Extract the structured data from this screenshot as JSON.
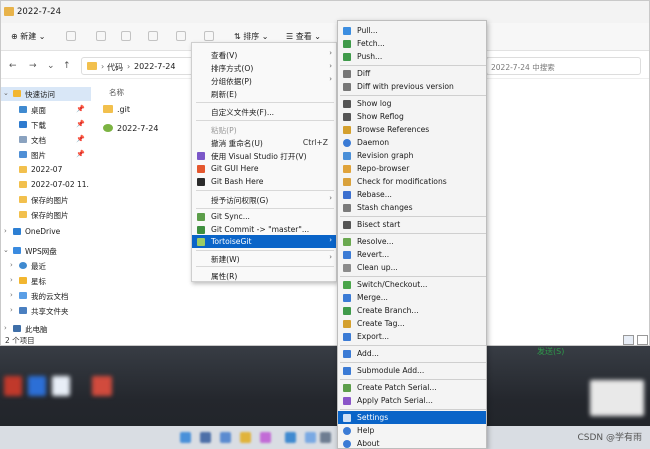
{
  "window": {
    "title": "2022-7-24"
  },
  "toolbar": {
    "new_label": "新建",
    "sort_label": "排序",
    "view_label": "查看"
  },
  "address": {
    "crumbs": [
      "代码",
      "2022-7-24"
    ],
    "search_placeholder": "2022-7-24 中搜索"
  },
  "sidebar": {
    "items": [
      {
        "label": "快速访问",
        "icon": "star-icon"
      },
      {
        "label": "桌面",
        "icon": "desktop-icon"
      },
      {
        "label": "下载",
        "icon": "download-icon"
      },
      {
        "label": "文档",
        "icon": "document-icon"
      },
      {
        "label": "图片",
        "icon": "picture-icon"
      },
      {
        "label": "2022-07",
        "icon": "folder-icon"
      },
      {
        "label": "2022-07-02 11.",
        "icon": "folder-icon"
      },
      {
        "label": "保存的图片",
        "icon": "folder-icon"
      },
      {
        "label": "保存的图片",
        "icon": "folder-icon"
      },
      {
        "label": "OneDrive",
        "icon": "cloud-icon"
      },
      {
        "label": "WPS网盘",
        "icon": "cloud-icon"
      },
      {
        "label": "最近",
        "icon": "clock-icon"
      },
      {
        "label": "星标",
        "icon": "star-icon"
      },
      {
        "label": "我的云文档",
        "icon": "cloud-icon"
      },
      {
        "label": "共享文件夹",
        "icon": "share-icon"
      },
      {
        "label": "此电脑",
        "icon": "computer-icon"
      }
    ]
  },
  "status": {
    "count": "2 个项目"
  },
  "content": {
    "column_name": "名称",
    "files": [
      {
        "name": ".git"
      },
      {
        "name": "2022-7-24"
      }
    ],
    "green_text": "发送(S)"
  },
  "menu1": {
    "items": [
      {
        "label": "查看(V)"
      },
      {
        "label": "排序方式(O)"
      },
      {
        "label": "分组依据(P)"
      },
      {
        "label": "刷新(E)"
      },
      {
        "label": "自定义文件夹(F)..."
      },
      {
        "label": "粘贴(P)"
      },
      {
        "label": "撤消 重命名(U)",
        "shortcut": "Ctrl+Z"
      },
      {
        "label": "使用 Visual Studio 打开(V)"
      },
      {
        "label": "Git GUI Here"
      },
      {
        "label": "Git Bash Here"
      },
      {
        "label": "授予访问权限(G)"
      },
      {
        "label": "Git Sync..."
      },
      {
        "label": "Git Commit -> \"master\"..."
      },
      {
        "label": "TortoiseGit"
      },
      {
        "label": "新建(W)"
      },
      {
        "label": "属性(R)"
      }
    ]
  },
  "menu2": {
    "items": [
      {
        "label": "Pull..."
      },
      {
        "label": "Fetch..."
      },
      {
        "label": "Push..."
      },
      {
        "label": "Diff"
      },
      {
        "label": "Diff with previous version"
      },
      {
        "label": "Show log"
      },
      {
        "label": "Show Reflog"
      },
      {
        "label": "Browse References"
      },
      {
        "label": "Daemon"
      },
      {
        "label": "Revision graph"
      },
      {
        "label": "Repo-browser"
      },
      {
        "label": "Check for modifications"
      },
      {
        "label": "Rebase..."
      },
      {
        "label": "Stash changes"
      },
      {
        "label": "Bisect start"
      },
      {
        "label": "Resolve..."
      },
      {
        "label": "Revert..."
      },
      {
        "label": "Clean up..."
      },
      {
        "label": "Switch/Checkout..."
      },
      {
        "label": "Merge..."
      },
      {
        "label": "Create Branch..."
      },
      {
        "label": "Create Tag..."
      },
      {
        "label": "Export..."
      },
      {
        "label": "Add..."
      },
      {
        "label": "Submodule Add..."
      },
      {
        "label": "Create Patch Serial..."
      },
      {
        "label": "Apply Patch Serial..."
      },
      {
        "label": "Settings"
      },
      {
        "label": "Help"
      },
      {
        "label": "About"
      }
    ]
  },
  "watermark": "CSDN @学有雨",
  "colors": {
    "highlight": "#0a64c8",
    "folder": "#f2c04d"
  }
}
